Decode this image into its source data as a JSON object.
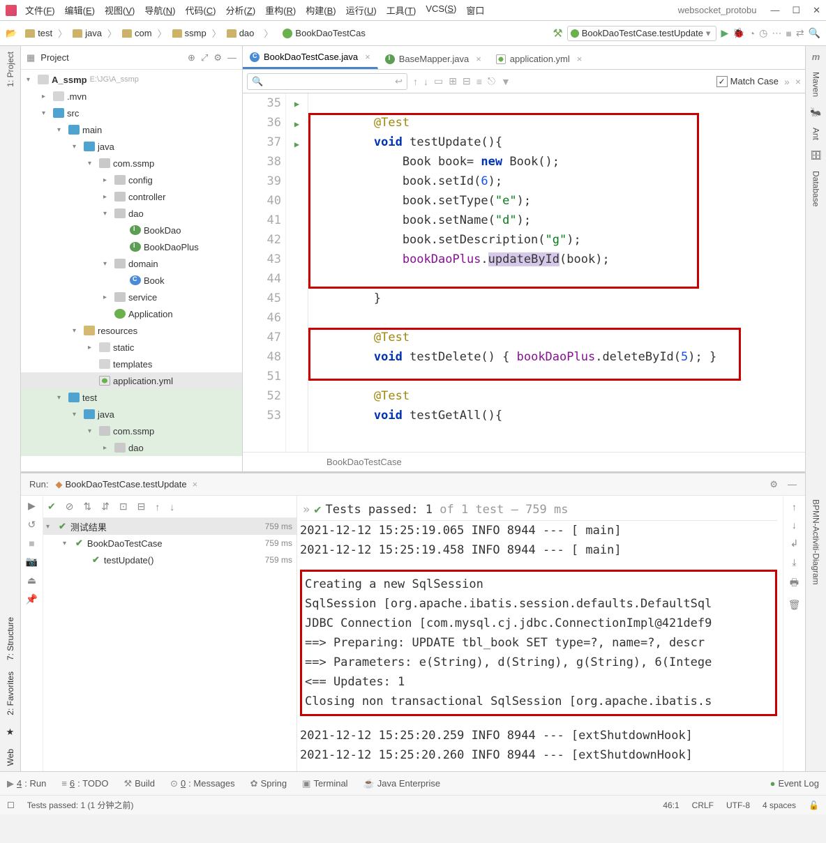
{
  "window": {
    "project_hint": "websocket_protobu"
  },
  "menubar": [
    "文件(F)",
    "编辑(E)",
    "视图(V)",
    "导航(N)",
    "代码(C)",
    "分析(Z)",
    "重构(R)",
    "构建(B)",
    "运行(U)",
    "工具(T)",
    "VCS(S)",
    "窗口"
  ],
  "breadcrumbs": [
    "test",
    "java",
    "com",
    "ssmp",
    "dao",
    "BookDaoTestCas"
  ],
  "run_config": "BookDaoTestCase.testUpdate",
  "project_panel": {
    "title": "Project"
  },
  "tree": {
    "root": "A_ssmp",
    "root_path": "E:\\JG\\A_ssmp",
    "items": [
      {
        "ind": 1,
        "chev": ">",
        "ico": "d",
        "label": ".mvn"
      },
      {
        "ind": 1,
        "chev": "v",
        "ico": "src",
        "label": "src"
      },
      {
        "ind": 2,
        "chev": "v",
        "ico": "src",
        "label": "main"
      },
      {
        "ind": 3,
        "chev": "v",
        "ico": "src",
        "label": "java"
      },
      {
        "ind": 4,
        "chev": "v",
        "ico": "pkg",
        "label": "com.ssmp"
      },
      {
        "ind": 5,
        "chev": ">",
        "ico": "pkg",
        "label": "config"
      },
      {
        "ind": 5,
        "chev": ">",
        "ico": "pkg",
        "label": "controller"
      },
      {
        "ind": 5,
        "chev": "v",
        "ico": "pkg",
        "label": "dao"
      },
      {
        "ind": 6,
        "chev": "",
        "ico": "iface",
        "label": "BookDao"
      },
      {
        "ind": 6,
        "chev": "",
        "ico": "iface",
        "label": "BookDaoPlus"
      },
      {
        "ind": 5,
        "chev": "v",
        "ico": "pkg",
        "label": "domain"
      },
      {
        "ind": 6,
        "chev": "",
        "ico": "cls",
        "label": "Book"
      },
      {
        "ind": 5,
        "chev": ">",
        "ico": "pkg",
        "label": "service"
      },
      {
        "ind": 5,
        "chev": "",
        "ico": "spring",
        "label": "Application"
      },
      {
        "ind": 3,
        "chev": "v",
        "ico": "res",
        "label": "resources"
      },
      {
        "ind": 4,
        "chev": ">",
        "ico": "d",
        "label": "static"
      },
      {
        "ind": 4,
        "chev": "",
        "ico": "d",
        "label": "templates"
      },
      {
        "ind": 4,
        "chev": "",
        "ico": "yml",
        "label": "application.yml",
        "sel": true
      },
      {
        "ind": 2,
        "chev": "v",
        "ico": "src",
        "label": "test",
        "green": true
      },
      {
        "ind": 3,
        "chev": "v",
        "ico": "src",
        "label": "java",
        "green": true
      },
      {
        "ind": 4,
        "chev": "v",
        "ico": "pkg",
        "label": "com.ssmp",
        "green": true
      },
      {
        "ind": 5,
        "chev": ">",
        "ico": "pkg",
        "label": "dao",
        "green": true
      }
    ]
  },
  "tabs": [
    {
      "label": "BookDaoTestCase.java",
      "active": true,
      "ico": "cls"
    },
    {
      "label": "BaseMapper.java",
      "active": false,
      "ico": "iface"
    },
    {
      "label": "application.yml",
      "active": false,
      "ico": "yml"
    }
  ],
  "find": {
    "match_case": "Match Case"
  },
  "code_lines": [
    {
      "n": 35,
      "html": ""
    },
    {
      "n": 36,
      "html": "        <span class='ann'>@Test</span>"
    },
    {
      "n": 37,
      "html": "        <span class='kw'>void</span> testUpdate(){",
      "run": true
    },
    {
      "n": 38,
      "html": "            Book book= <span class='kw'>new</span> Book();"
    },
    {
      "n": 39,
      "html": "            book.setId(<span class='num'>6</span>);"
    },
    {
      "n": 40,
      "html": "            book.setType(<span class='str'>\"e\"</span>);"
    },
    {
      "n": 41,
      "html": "            book.setName(<span class='str'>\"d\"</span>);"
    },
    {
      "n": 42,
      "html": "            book.setDescription(<span class='str'>\"g\"</span>);"
    },
    {
      "n": 43,
      "html": "            <span class='fld'>bookDaoPlus</span>.<span class='hl-id'>updateById</span>(book);"
    },
    {
      "n": 44,
      "html": ""
    },
    {
      "n": 45,
      "html": "        }"
    },
    {
      "n": 46,
      "html": ""
    },
    {
      "n": 47,
      "html": "        <span class='ann'>@Test</span>"
    },
    {
      "n": 48,
      "html": "        <span class='kw'>void</span> testDelete() { <span class='fld'>bookDaoPlus</span>.deleteById(<span class='num'>5</span>); }",
      "run": true
    },
    {
      "n": 51,
      "html": ""
    },
    {
      "n": 52,
      "html": "        <span class='ann'>@Test</span>"
    },
    {
      "n": 53,
      "html": "        <span class='kw'>void</span> testGetAll(){",
      "run": true
    }
  ],
  "editor_breadcrumb": "BookDaoTestCase",
  "run_panel": {
    "title": "Run:",
    "config": "BookDaoTestCase.testUpdate",
    "summary": "Tests passed: 1",
    "summary_tail": " of 1 test – 759 ms",
    "tree": [
      {
        "ind": 0,
        "label": "测试结果",
        "time": "759 ms",
        "hdr": true
      },
      {
        "ind": 1,
        "label": "BookDaoTestCase",
        "time": "759 ms"
      },
      {
        "ind": 2,
        "label": "testUpdate()",
        "time": "759 ms"
      }
    ],
    "console_top": [
      "2021-12-12 15:25:19.065  INFO 8944 --- [           main]",
      "2021-12-12 15:25:19.458  INFO 8944 --- [           main]"
    ],
    "console_box": [
      "Creating a new SqlSession",
      "SqlSession [org.apache.ibatis.session.defaults.DefaultSql",
      "JDBC Connection [com.mysql.cj.jdbc.ConnectionImpl@421def9",
      "==>  Preparing: UPDATE tbl_book SET type=?, name=?, descr",
      "==> Parameters: e(String), d(String), g(String), 6(Intege",
      "<==    Updates: 1",
      "Closing non transactional SqlSession [org.apache.ibatis.s"
    ],
    "console_bottom": [
      "2021-12-12 15:25:20.259  INFO 8944 --- [extShutdownHook]",
      "2021-12-12 15:25:20.260  INFO 8944 --- [extShutdownHook]"
    ]
  },
  "bottom_tabs": [
    {
      "label": "4: Run",
      "u": "4"
    },
    {
      "label": "6: TODO",
      "u": "6"
    },
    {
      "label": "Build",
      "u": ""
    },
    {
      "label": "0: Messages",
      "u": "0"
    },
    {
      "label": "Spring",
      "u": ""
    },
    {
      "label": "Terminal",
      "u": ""
    },
    {
      "label": "Java Enterprise",
      "u": ""
    }
  ],
  "event_log": "Event Log",
  "statusbar": {
    "msg": "Tests passed: 1 (1 分钟之前)",
    "pos": "46:1",
    "eol": "CRLF",
    "enc": "UTF-8",
    "indent": "4 spaces"
  },
  "right_tools": [
    "Maven",
    "Ant",
    "Database",
    "BPMN-Activiti-Diagram"
  ],
  "left_tools": [
    "1: Project",
    "7: Structure",
    "2: Favorites",
    "Web"
  ]
}
